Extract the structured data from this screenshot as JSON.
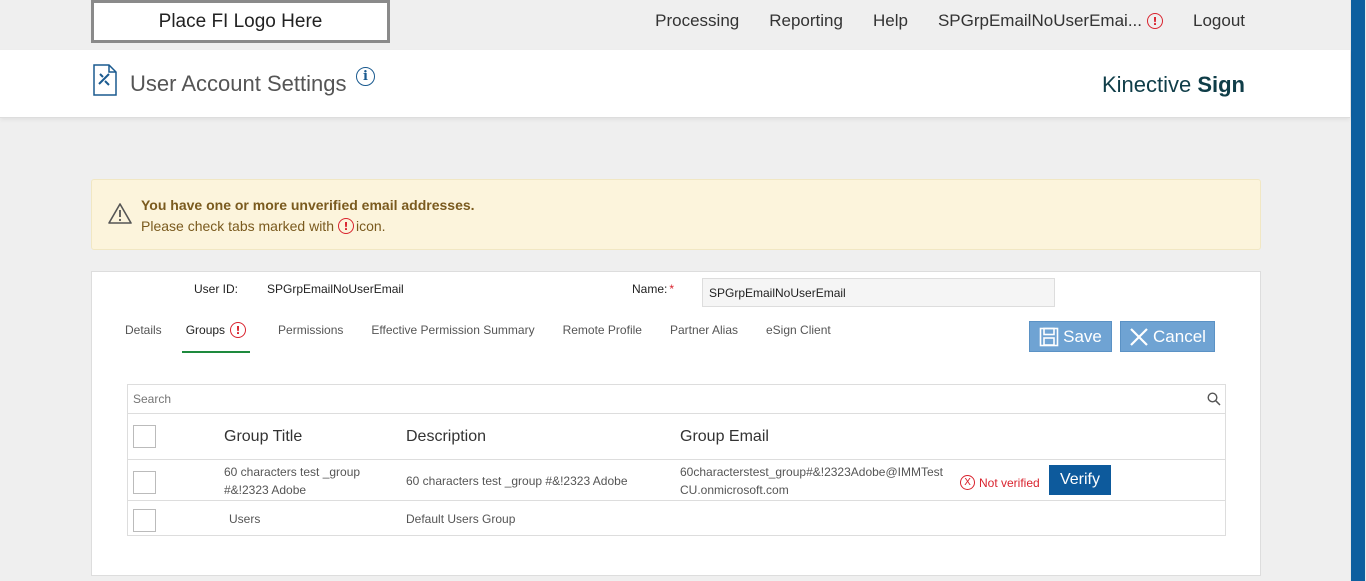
{
  "topbar": {
    "logo_text": "Place FI Logo Here",
    "nav": {
      "processing": "Processing",
      "reporting": "Reporting",
      "help": "Help",
      "user": "SPGrpEmailNoUserEmai...",
      "logout": "Logout"
    },
    "warn_glyph": "!"
  },
  "header": {
    "title": "User Account Settings",
    "info_glyph": "i",
    "brand_light": "Kinective ",
    "brand_bold": "Sign"
  },
  "alert": {
    "title": "You have one or more unverified email addresses.",
    "text_before": "Please check tabs marked with",
    "text_after": "icon.",
    "warn_glyph": "!"
  },
  "form": {
    "user_id_label": "User ID:",
    "user_id_value": "SPGrpEmailNoUserEmail",
    "name_label": "Name:",
    "required_mark": "*",
    "name_value": "SPGrpEmailNoUserEmail"
  },
  "tabs": {
    "details": "Details",
    "groups": "Groups",
    "permissions": "Permissions",
    "effective": "Effective Permission Summary",
    "remote": "Remote Profile",
    "partner": "Partner Alias",
    "esign": "eSign Client",
    "active": "Groups"
  },
  "actions": {
    "save": "Save",
    "cancel": "Cancel"
  },
  "grid": {
    "search_placeholder": "Search",
    "columns": {
      "title": "Group Title",
      "description": "Description",
      "email": "Group Email"
    },
    "rows": [
      {
        "title": "60 characters test _group #&!2323 Adobe",
        "description": "60 characters test _group #&!2323 Adobe",
        "email": "60characterstest_group#&!2323Adobe@IMMTestCU.onmicrosoft.com",
        "status": "Not verified",
        "action": "Verify"
      },
      {
        "title": "Users",
        "description": "Default Users Group",
        "email": "",
        "status": "",
        "action": ""
      }
    ]
  },
  "colors": {
    "accent": "#0d5a9c",
    "warning": "#d9232e",
    "tab_active_underline": "#1e8a3e",
    "button_light": "#6fa3d3",
    "alert_bg": "#fcf4dc"
  }
}
